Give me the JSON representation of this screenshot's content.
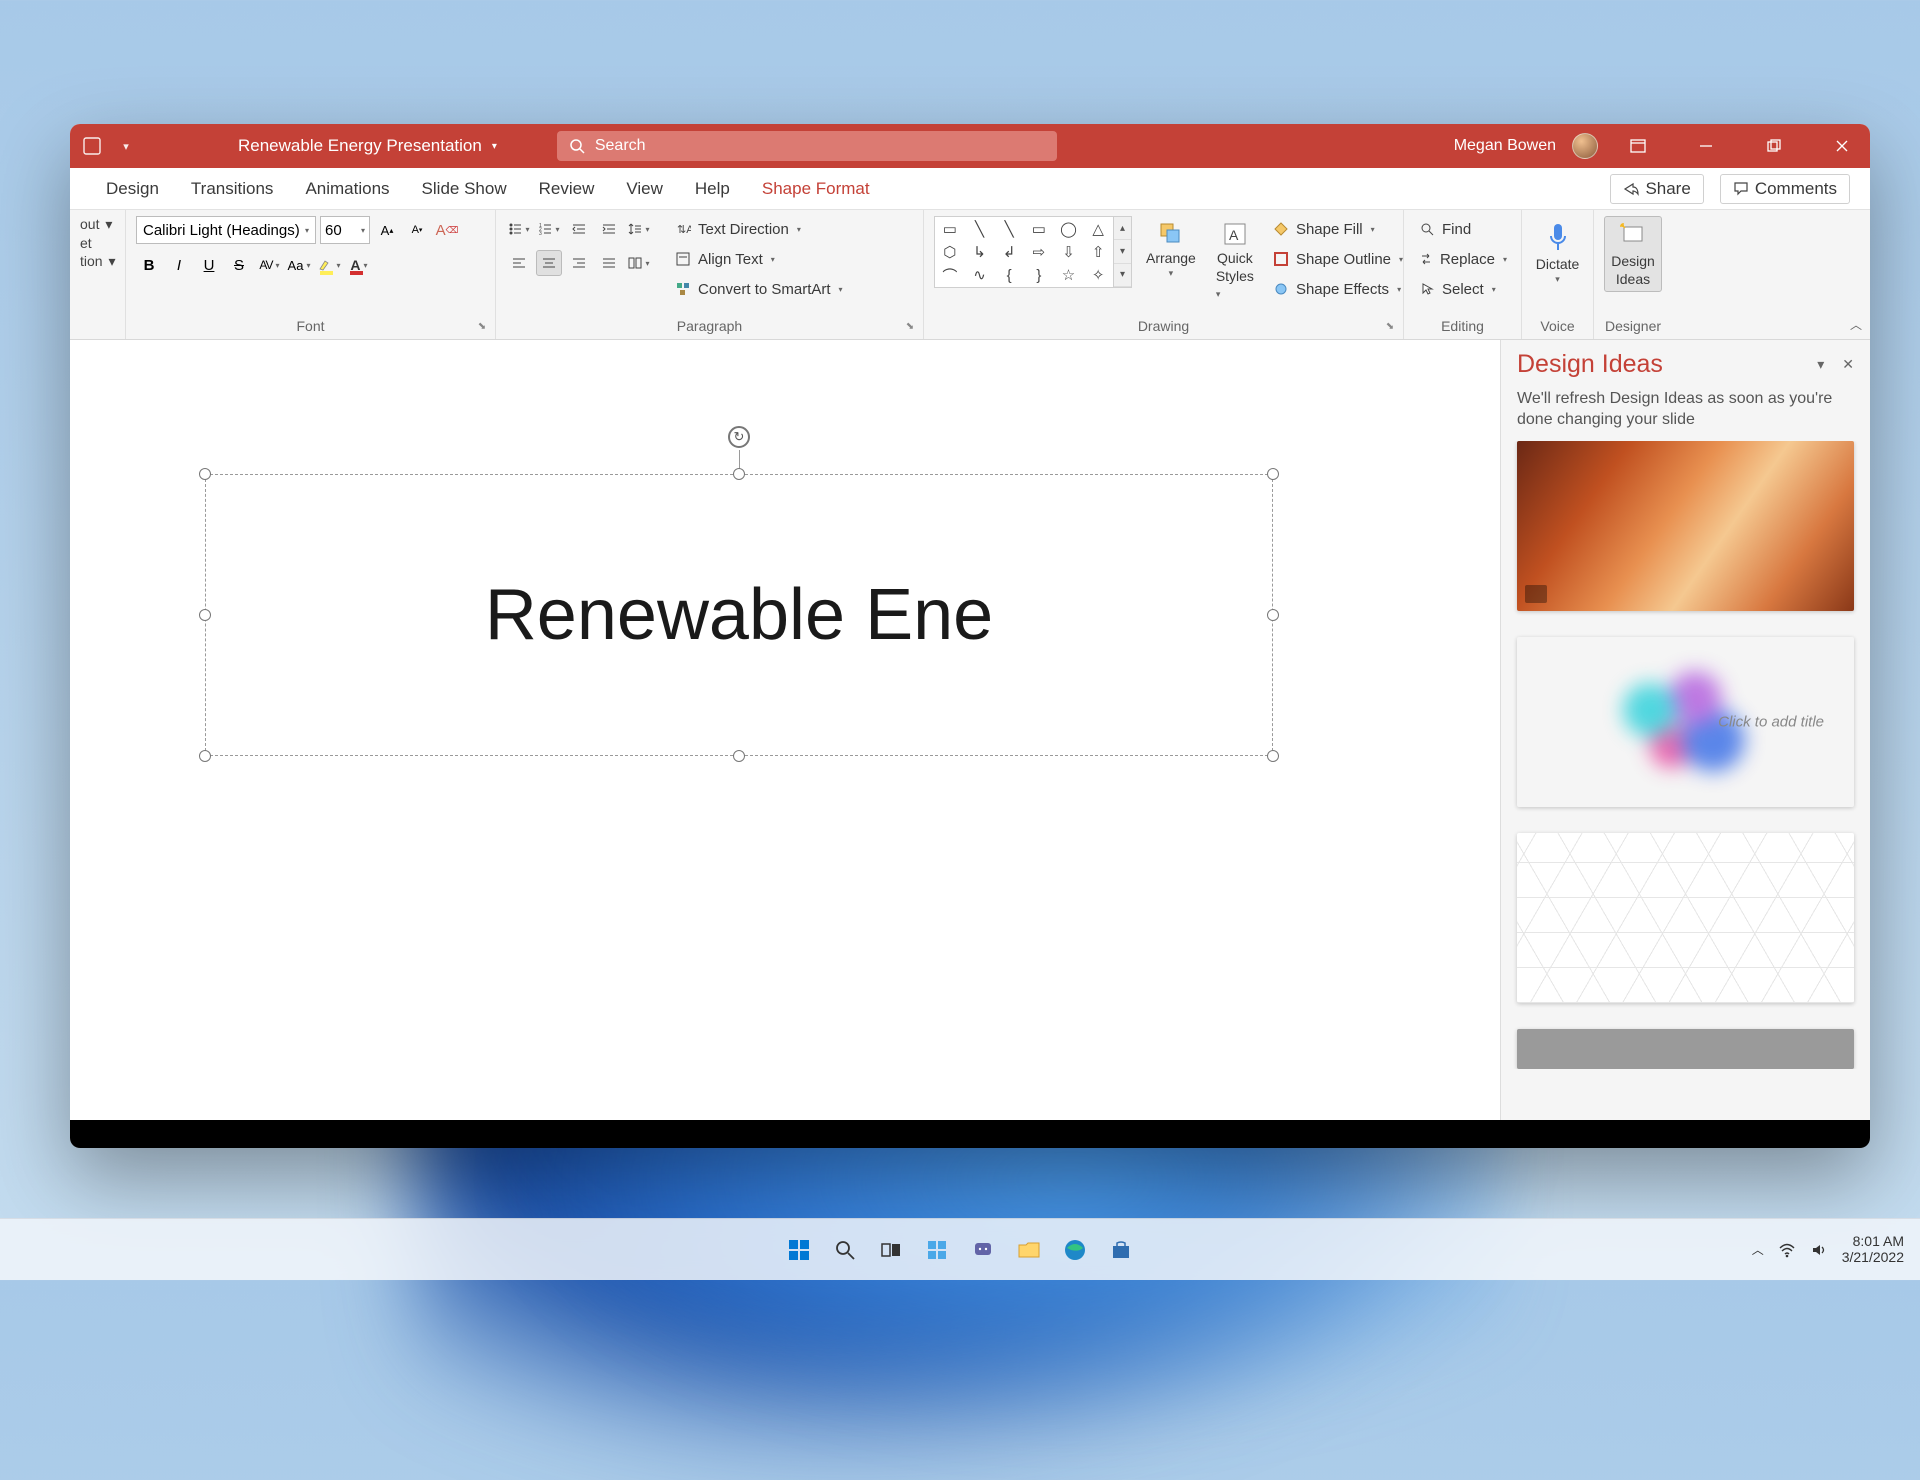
{
  "title_bar": {
    "document_title": "Renewable Energy Presentation",
    "search_placeholder": "Search",
    "user_name": "Megan Bowen"
  },
  "tabs": {
    "design": "Design",
    "transitions": "Transitions",
    "animations": "Animations",
    "slide_show": "Slide Show",
    "review": "Review",
    "view": "View",
    "help": "Help",
    "shape_format": "Shape Format",
    "share": "Share",
    "comments": "Comments"
  },
  "ribbon": {
    "partial": {
      "item1": "out",
      "item2": "et",
      "item3": "tion"
    },
    "font": {
      "group_label": "Font",
      "font_name": "Calibri Light (Headings)",
      "font_size": "60",
      "bold": "B",
      "italic": "I",
      "underline": "U",
      "strike": "S",
      "spacing": "AV",
      "case": "Aa"
    },
    "paragraph": {
      "group_label": "Paragraph",
      "text_direction": "Text Direction",
      "align_text": "Align Text",
      "convert_smartart": "Convert to SmartArt"
    },
    "drawing": {
      "group_label": "Drawing",
      "arrange": "Arrange",
      "quick_styles_l1": "Quick",
      "quick_styles_l2": "Styles",
      "shape_fill": "Shape Fill",
      "shape_outline": "Shape Outline",
      "shape_effects": "Shape Effects"
    },
    "editing": {
      "group_label": "Editing",
      "find": "Find",
      "replace": "Replace",
      "select": "Select"
    },
    "voice": {
      "group_label": "Voice",
      "dictate": "Dictate"
    },
    "designer": {
      "group_label": "Designer",
      "design_ideas_l1": "Design",
      "design_ideas_l2": "Ideas"
    }
  },
  "slide": {
    "title_text": "Renewable Ene"
  },
  "design_pane": {
    "title": "Design Ideas",
    "hint": "We'll refresh Design Ideas as soon as you're done changing your slide",
    "idea2_text": "Click to add title"
  },
  "taskbar": {
    "time": "8:01 AM",
    "date": "3/21/2022"
  }
}
